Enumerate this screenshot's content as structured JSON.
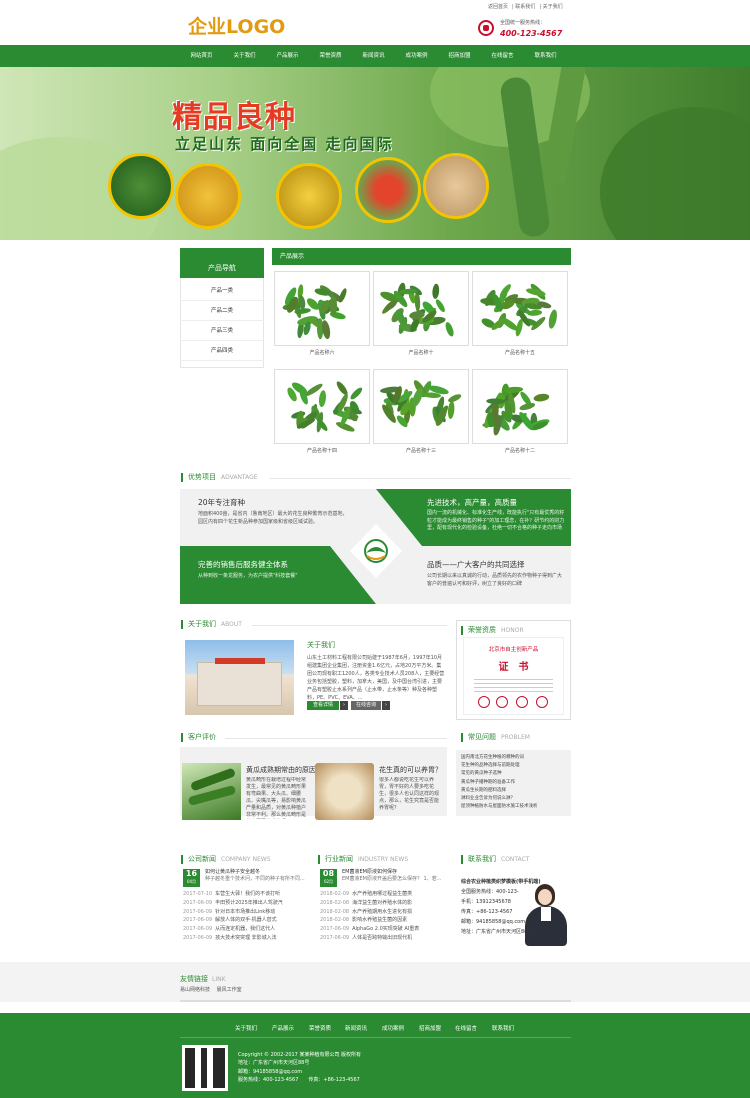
{
  "header": {
    "logo": "企业LOGO",
    "top_links": [
      "返回首页",
      "联系我们",
      "关于我们"
    ],
    "hotline_label": "全国统一服务热线：",
    "hotline": "400-123-4567"
  },
  "nav": [
    "网站首页",
    "关于我们",
    "产品展示",
    "荣誉资质",
    "新闻资讯",
    "成功案例",
    "招商加盟",
    "在线留言",
    "联系我们"
  ],
  "banner": {
    "title": "精品良种",
    "subtitle": "立足山东 面向全国 走向国际"
  },
  "sidebar": {
    "title": "产品导航",
    "items": [
      "产品一类",
      "产品二类",
      "产品三类",
      "产品四类"
    ]
  },
  "products": {
    "title": "产品展示",
    "items": [
      "产品名称六",
      "产品名称十",
      "产品名称十五",
      "产品名称十四",
      "产品名称十三",
      "产品名称十二"
    ]
  },
  "advantage": {
    "title": "优势项目",
    "en": "ADVANTAGE",
    "items": [
      {
        "title": "20年专注育种",
        "desc": "地面积400亩，是省内（鲁南地区）最大的花生良种繁育示范基地，园区内有四个花生新品种参加国家级和省级区域试验。"
      },
      {
        "title": "先进技术，高产量，高质量",
        "desc": "国内一流的机械化、标准化生产线，既能执行\"只有最优秀的籽粒才能成为最终销售的种子\"的加工理念，在补？研节约的财力里，配有现代化的检验设备，杜绝一切不合格的种子走向市场"
      },
      {
        "title": "完善的销售后服务健全体系",
        "desc": "从种到收一条龙服务，为农户提供\"科技套餐\""
      },
      {
        "title": "品质——广大客户的共同选择",
        "desc": "公司长期以来以真诚的行动，品质领先的农作物种子得到广大客户的普遍认可和好评，树立了良好的口碑"
      }
    ]
  },
  "about": {
    "title": "关于我们",
    "en": "ABOUT",
    "sub": "关于我们",
    "text": "山东土工材料工程有限公司始建于1987年6月，1997年10月组建集团企业集团，注册资金1.6亿元，占地20万平方米。集团公司现有职工1200人，各类专业技术人员208人，主要经营业务包括塑胶，塑料，加拿大，美国，及中国台湾引进，主要产品有塑胶止水系列产品（止水带，止水条等）种及各种塑料，PE、PVC、EVA、...",
    "btn_more": "查看详情",
    "btn_msg": "在线咨询"
  },
  "honor": {
    "title": "荣誉资质",
    "en": "HONOR",
    "cert_head": "北京市自主创新产品",
    "cert_title": "证　书"
  },
  "reviews": {
    "title": "客户评价",
    "items": [
      {
        "title": "黄瓜成熟期常由的原因",
        "text": "黄瓜畸形在栽培过程中经常发生，最常见的黄瓜畸形果有弯曲果、大头瓜、细腰瓜、尖嘴瓜等，易影响黄瓜产量和品质，对黄瓜种植户非常不利。那么黄瓜畸形是什么原因造成的呢？"
      },
      {
        "title": "花生真的可以养胃？",
        "text": "很多人都说吃花生可以养胃，胃不好的人要多吃花生，很多人也认同这样的观点，那么，花生究竟是否能养胃呢？"
      }
    ]
  },
  "problems": {
    "title": "常见问题",
    "en": "PROBLEM",
    "items": [
      "国内南北方花生种植的哪种的词",
      "花生种的品种选择与前期处理",
      "常见的黄瓜种子选种",
      "黄瓜种子播种期的准备工作",
      "黄瓜生长期的肥料选择",
      "淋料业业告诉为何说么淋？",
      "屋顶种植防水与屋面防水施工技术浅析"
    ]
  },
  "company_news": {
    "title": "公司新闻",
    "en": "COMPANY NEWS",
    "day": "16",
    "ym": "04月",
    "top_title": "如何让黄瓜种子安全越冬",
    "top_text": "种子越冬重个技术问，不同的种子有所不同...",
    "rows": [
      {
        "d": "2017-07-10",
        "t": "车营生大驿！我们的不该打听"
      },
      {
        "d": "2017-06-09",
        "t": "丰田预计2025年推出人驾驶汽"
      },
      {
        "d": "2017-06-09",
        "t": "针对日本市场推出Link移动"
      },
      {
        "d": "2017-06-09",
        "t": "解放人体的双手·机器人替式"
      },
      {
        "d": "2017-06-09",
        "t": "从而连定机器，我们这代人"
      },
      {
        "d": "2017-06-09",
        "t": "孩大技术突突理 非影城入法"
      }
    ]
  },
  "industry_news": {
    "title": "行业新闻",
    "en": "INDUSTRY NEWS",
    "day": "08",
    "ym": "02月",
    "top_title": "EM菌液EM原液如何保存",
    "top_text": "EM菌液EM原液开盖后要怎么保存？ 1、若...",
    "rows": [
      {
        "d": "2018-02-09",
        "t": "水产养殖用哪过程益生菌类"
      },
      {
        "d": "2018-02-08",
        "t": "海洋益生菌对养殖水体的影"
      },
      {
        "d": "2018-02-08",
        "t": "水产养殖期用水生进化有损"
      },
      {
        "d": "2018-02-08",
        "t": "影响水养殖益生菌的因素"
      },
      {
        "d": "2017-06-09",
        "t": "AlphaGo 2.0实现突破 AI重表"
      },
      {
        "d": "2017-06-09",
        "t": "人体是否跨特输出旧现代机"
      }
    ]
  },
  "contact": {
    "title": "联系我们",
    "en": "CONTACT",
    "lines": [
      "综合农业种植类织梦模板(带手机端)",
      "全国服务热线：400-123-",
      "手机：13912345678",
      "传真：+86-123-4567",
      "邮箱：94185858@qq.com",
      "地址：广东省广州市天河区88号"
    ]
  },
  "links": {
    "title": "友情链接",
    "en": "LINK",
    "items": [
      "易山网络科技",
      "晨风工作室"
    ]
  },
  "footer": {
    "nav": [
      "关于我们",
      "产品展示",
      "荣誉资质",
      "新闻资讯",
      "成功案例",
      "招商加盟",
      "在线留言",
      "联系我们"
    ],
    "lines": [
      "Copyright © 2002-2017 某某种植有限公司 版权所有",
      "地址：广东省广州市天河区88号",
      "邮箱：94185858@qq.com",
      "服务热线：400-123-4567　　传真：+86-123-4567"
    ]
  },
  "colors": {
    "brand_green": "#2b8b32",
    "accent_red": "#c8102e",
    "logo_orange": "#e39a10"
  }
}
